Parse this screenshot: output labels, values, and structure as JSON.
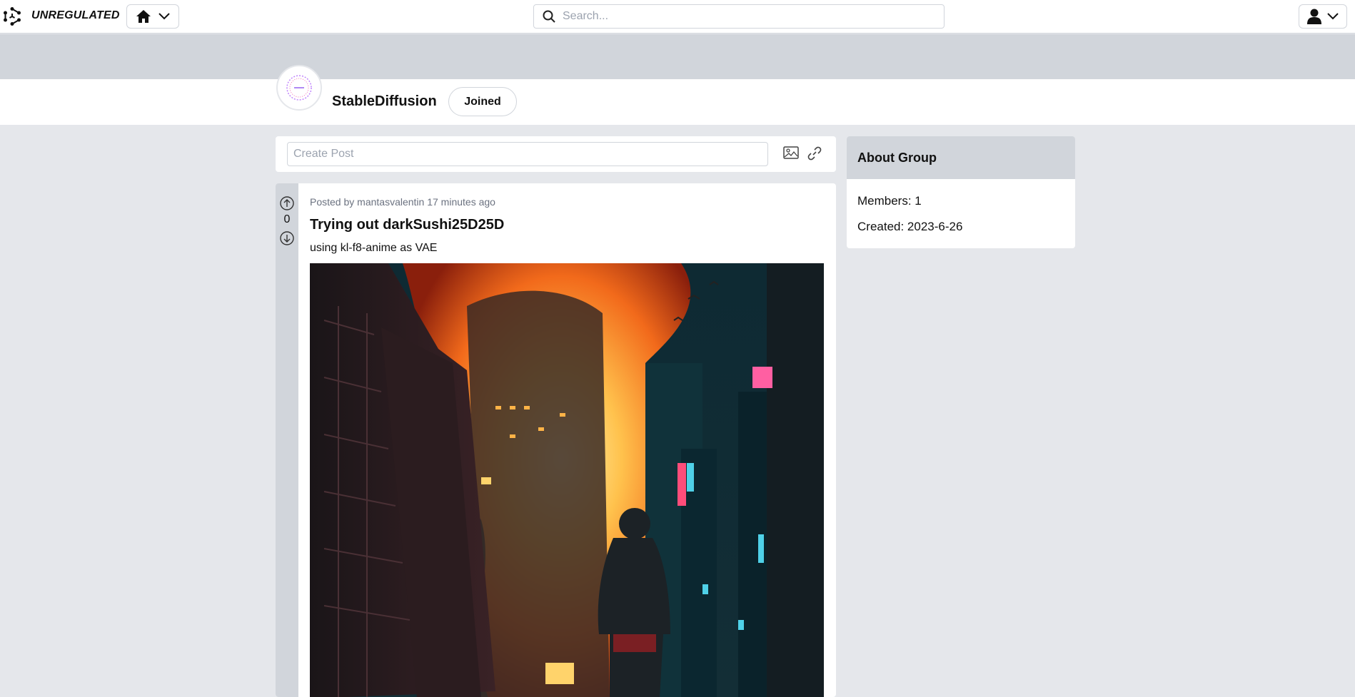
{
  "app": {
    "brand": "UNREGULATED",
    "logo_icon": "hexagon-nodes-icon"
  },
  "nav": {
    "home_icon": "home-icon",
    "chevron_icon": "chevron-down-icon",
    "user_icon": "user-icon",
    "search": {
      "placeholder": "Search...",
      "value": ""
    }
  },
  "group": {
    "name": "StableDiffusion",
    "join_button": "Joined",
    "avatar_icon": "group-avatar-icon"
  },
  "create_post": {
    "placeholder": "Create Post",
    "image_icon": "image-icon",
    "link_icon": "link-icon"
  },
  "posts": [
    {
      "posted_by_prefix": "Posted by",
      "author": "mantasvalentin",
      "time_ago": "17 minutes ago",
      "title": "Trying out darkSushi25D25D",
      "body": "using kl-f8-anime as VAE",
      "votes": "0",
      "image_description": "anime-style city street on fire at night"
    }
  ],
  "about": {
    "title": "About Group",
    "members_label": "Members: 1",
    "created_label": "Created: 2023-6-26"
  },
  "colors": {
    "page_bg": "#e5e7eb",
    "panel_gray": "#d1d5db",
    "white": "#ffffff",
    "meta_text": "#6b7280"
  }
}
